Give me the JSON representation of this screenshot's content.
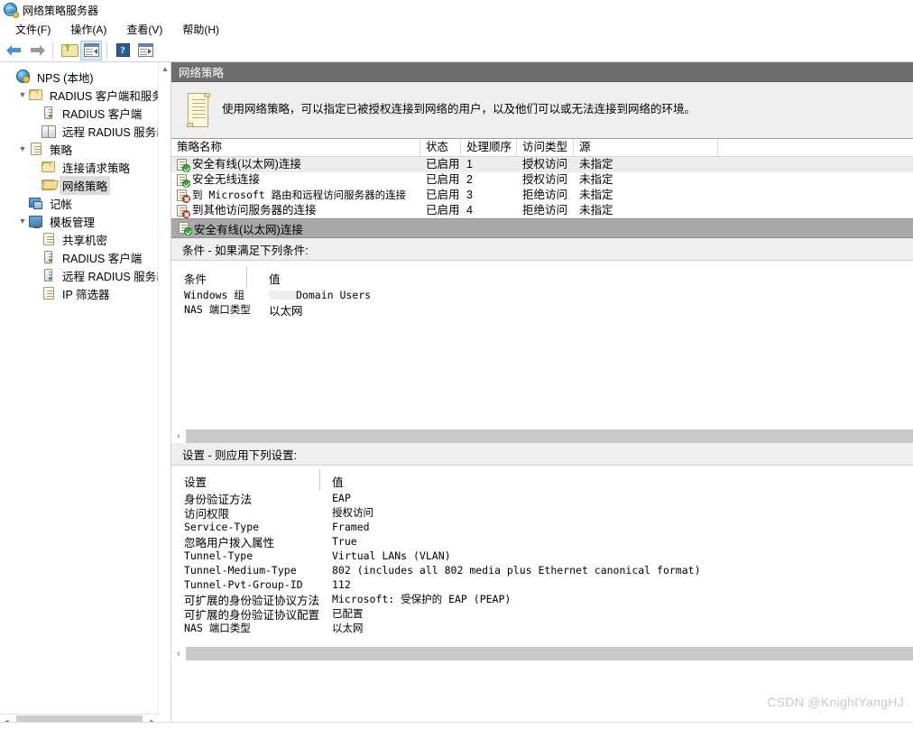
{
  "window": {
    "title": "网络策略服务器",
    "icon": "nps-globe-icon"
  },
  "menu": {
    "items": [
      {
        "label": "文件(F)"
      },
      {
        "label": "操作(A)"
      },
      {
        "label": "查看(V)"
      },
      {
        "label": "帮助(H)"
      }
    ]
  },
  "toolbar": {
    "buttons": [
      {
        "name": "back-button",
        "icon": "arrow-left-icon"
      },
      {
        "name": "forward-button",
        "icon": "arrow-right-icon"
      },
      {
        "name": "up-one-level-button",
        "icon": "folder-up-icon"
      },
      {
        "name": "show-hide-tree-button",
        "icon": "console-tree-icon",
        "active": true
      },
      {
        "name": "help-button",
        "icon": "question-mark-icon",
        "glyph": "?"
      },
      {
        "name": "properties-button",
        "icon": "properties-pane-icon"
      }
    ]
  },
  "tree": {
    "items": [
      {
        "label": "NPS (本地)",
        "icon": "nps-globe-icon",
        "level": 0,
        "expander": "none",
        "selected": false
      },
      {
        "label": "RADIUS 客户端和服务器",
        "icon": "folder-icon",
        "level": 1,
        "expander": "expanded",
        "selected": false
      },
      {
        "label": "RADIUS 客户端",
        "icon": "server-icon",
        "level": 2,
        "expander": "none",
        "selected": false
      },
      {
        "label": "远程 RADIUS 服务器组",
        "icon": "server-group-icon",
        "level": 2,
        "expander": "none",
        "selected": false
      },
      {
        "label": "策略",
        "icon": "document-icon",
        "level": 1,
        "expander": "expanded",
        "selected": false
      },
      {
        "label": "连接请求策略",
        "icon": "folder-icon",
        "level": 2,
        "expander": "none",
        "selected": false
      },
      {
        "label": "网络策略",
        "icon": "folder-open-icon",
        "level": 2,
        "expander": "none",
        "selected": true
      },
      {
        "label": "记帐",
        "icon": "accounting-icon",
        "level": 1,
        "expander": "none",
        "selected": false
      },
      {
        "label": "模板管理",
        "icon": "monitor-icon",
        "level": 1,
        "expander": "expanded",
        "selected": false
      },
      {
        "label": "共享机密",
        "icon": "document-icon",
        "level": 2,
        "expander": "none",
        "selected": false
      },
      {
        "label": "RADIUS 客户端",
        "icon": "server-icon",
        "level": 2,
        "expander": "none",
        "selected": false
      },
      {
        "label": "远程 RADIUS 服务器",
        "icon": "server-icon",
        "level": 2,
        "expander": "none",
        "selected": false
      },
      {
        "label": "IP 筛选器",
        "icon": "document-icon",
        "level": 2,
        "expander": "none",
        "selected": false
      }
    ]
  },
  "content": {
    "header": "网络策略",
    "description": "使用网络策略，可以指定已被授权连接到网络的用户，以及他们可以或无法连接到网络的环境。",
    "policy_table": {
      "columns": [
        "策略名称",
        "状态",
        "处理顺序",
        "访问类型",
        "源"
      ],
      "rows": [
        {
          "name": "安全有线(以太网)连接",
          "name_mono": false,
          "status": "已启用",
          "order": "1",
          "access": "授权访问",
          "source": "未指定",
          "icon": "policy-allow-icon",
          "selected": true
        },
        {
          "name": "安全无线连接",
          "name_mono": false,
          "status": "已启用",
          "order": "2",
          "access": "授权访问",
          "source": "未指定",
          "icon": "policy-allow-icon",
          "selected": false
        },
        {
          "name": "到 Microsoft 路由和远程访问服务器的连接",
          "name_mono": true,
          "status": "已启用",
          "order": "3",
          "access": "拒绝访问",
          "source": "未指定",
          "icon": "policy-deny-icon",
          "selected": false
        },
        {
          "name": "到其他访问服务器的连接",
          "name_mono": false,
          "status": "已启用",
          "order": "4",
          "access": "拒绝访问",
          "source": "未指定",
          "icon": "policy-deny-icon",
          "selected": false
        }
      ]
    },
    "detail": {
      "header": "安全有线(以太网)连接",
      "conditions_title": "条件 - 如果满足下列条件:",
      "conditions_columns": [
        "条件",
        "值"
      ],
      "conditions": [
        {
          "condition": "Windows 组",
          "value": "Domain Users",
          "redacted": true
        },
        {
          "condition": "NAS 端口类型",
          "value": "以太网",
          "redacted": false
        }
      ],
      "settings_title": "设置 - 则应用下列设置:",
      "settings_columns": [
        "设置",
        "值"
      ],
      "settings": [
        {
          "setting": "身份验证方法",
          "value": "EAP"
        },
        {
          "setting": "访问权限",
          "value": "授权访问"
        },
        {
          "setting": "Service-Type",
          "value": "Framed"
        },
        {
          "setting": "忽略用户拨入属性",
          "value": "True"
        },
        {
          "setting": "Tunnel-Type",
          "value": "Virtual LANs (VLAN)"
        },
        {
          "setting": "Tunnel-Medium-Type",
          "value": "802 (includes all 802 media plus Ethernet canonical format)"
        },
        {
          "setting": "Tunnel-Pvt-Group-ID",
          "value": "112"
        },
        {
          "setting": "可扩展的身份验证协议方法",
          "value": "Microsoft: 受保护的 EAP (PEAP)"
        },
        {
          "setting": "可扩展的身份验证协议配置",
          "value": "已配置"
        },
        {
          "setting": "NAS 端口类型",
          "value": "以太网"
        }
      ]
    }
  },
  "watermark": "CSDN @KnightYangHJ",
  "colors": {
    "header_dark": "#6e6e6e",
    "header_gray": "#a9a9a9",
    "section_bg": "#efefef",
    "selection": "#ededed",
    "allow": "#3aa93a",
    "deny": "#d63b2f"
  }
}
